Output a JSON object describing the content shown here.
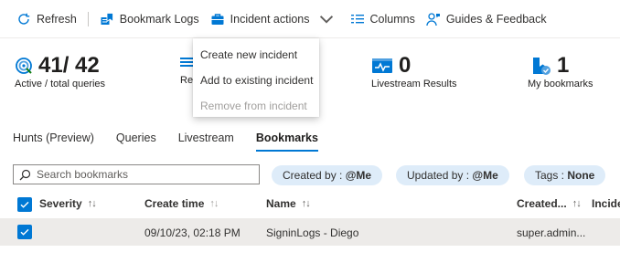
{
  "toolbar": {
    "refresh": "Refresh",
    "bookmark_logs": "Bookmark Logs",
    "incident_actions": "Incident actions",
    "columns": "Columns",
    "guides": "Guides & Feedback"
  },
  "dropdown": {
    "items": [
      {
        "label": "Create new incident",
        "disabled": false
      },
      {
        "label": "Add to existing incident",
        "disabled": false
      },
      {
        "label": "Remove from incident",
        "disabled": true
      }
    ]
  },
  "metrics": {
    "queries": {
      "value": "41/ 42",
      "label": "Active / total queries",
      "icon": "target-icon"
    },
    "results": {
      "label": "Re",
      "icon": "results-icon"
    },
    "livestream": {
      "value": "0",
      "label": "Livestream Results",
      "icon": "livestream-icon"
    },
    "bookmarks": {
      "value": "1",
      "label": "My bookmarks",
      "icon": "bookmark-icon"
    }
  },
  "tabs": [
    {
      "label": "Hunts (Preview)",
      "active": false
    },
    {
      "label": "Queries",
      "active": false
    },
    {
      "label": "Livestream",
      "active": false
    },
    {
      "label": "Bookmarks",
      "active": true
    }
  ],
  "search": {
    "placeholder": "Search bookmarks"
  },
  "filters": [
    {
      "key": "Created by : ",
      "value": "@Me"
    },
    {
      "key": "Updated by : ",
      "value": "@Me"
    },
    {
      "key": "Tags : ",
      "value": "None"
    }
  ],
  "table": {
    "columns": [
      "Severity",
      "Create time",
      "Name",
      "Created...",
      "Incide"
    ],
    "sort_glyph": "↑↓",
    "rows": [
      {
        "severity": "",
        "create_time": "09/10/23, 02:18 PM",
        "name": "SigninLogs - Diego",
        "created_by": "super.admin..."
      }
    ]
  },
  "colors": {
    "accent": "#0078d4",
    "pill_bg": "#deecf9",
    "selected_row": "#edebe9"
  }
}
